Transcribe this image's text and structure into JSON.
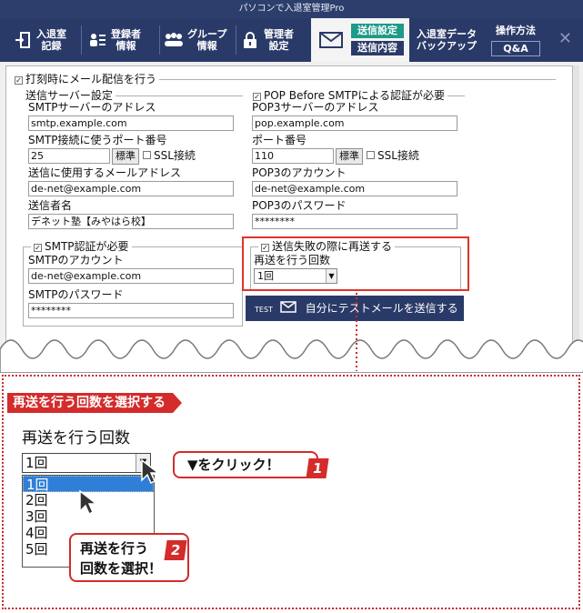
{
  "window_title": "パソコンで入退室管理Pro",
  "toolbar": {
    "items": [
      {
        "label1": "入退室",
        "label2": "記録",
        "icon": "door-exit-icon"
      },
      {
        "label1": "登録者",
        "label2": "情報",
        "icon": "person-list-icon"
      },
      {
        "label1": "グループ",
        "label2": "情報",
        "icon": "group-icon"
      },
      {
        "label1": "管理者",
        "label2": "設定",
        "icon": "lock-icon"
      }
    ],
    "mail": {
      "tag_send_settings": "送信設定",
      "tag_send_content": "送信内容"
    },
    "backup": {
      "line1": "入退室データ",
      "line2": "バックアップ"
    },
    "howto": "操作方法",
    "qa": "Q&A",
    "close": "✕"
  },
  "form": {
    "send_mail_on_stamp": "打刻時にメール配信を行う",
    "server_group": "送信サーバー設定",
    "smtp_addr_label": "SMTPサーバーのアドレス",
    "smtp_addr": "smtp.example.com",
    "smtp_port_label": "SMTP接続に使うポート番号",
    "smtp_port": "25",
    "standard_btn": "標準",
    "ssl_label": "SSL接続",
    "from_addr_label": "送信に使用するメールアドレス",
    "from_addr": "de-net@example.com",
    "sender_label": "送信者名",
    "sender": "デネット塾【みやはら校】",
    "pop_group": "POP Before SMTPによる認証が必要",
    "pop_addr_label": "POP3サーバーのアドレス",
    "pop_addr": "pop.example.com",
    "pop_port_label": "ポート番号",
    "pop_port": "110",
    "pop_account_label": "POP3のアカウント",
    "pop_account": "de-net@example.com",
    "pop_pass_label": "POP3のパスワード",
    "pop_pass": "********",
    "smtp_auth_group": "SMTP認証が必要",
    "smtp_account_label": "SMTPのアカウント",
    "smtp_account": "de-net@example.com",
    "smtp_pass_label": "SMTPのパスワード",
    "smtp_pass": "********",
    "resend_group": "送信失敗の際に再送する",
    "resend_count_label": "再送を行う回数",
    "resend_count": "1回",
    "test_btn_prefix": "TEST",
    "test_btn": "自分にテストメールを送信する"
  },
  "zoom": {
    "title": "再送を行う回数を選択する",
    "label": "再送を行う回数",
    "selected": "1回",
    "options": [
      "1回",
      "2回",
      "3回",
      "4回",
      "5回"
    ],
    "callout1": "▼をクリック！",
    "callout1_num": "1",
    "callout2_line1": "再送を行う",
    "callout2_line2": "回数を選択！",
    "callout2_num": "2"
  },
  "colors": {
    "accent_red": "#d42b2b",
    "toolbar_navy": "#2a3a68",
    "teal": "#1d9a88",
    "select_blue": "#2f7fd8"
  }
}
